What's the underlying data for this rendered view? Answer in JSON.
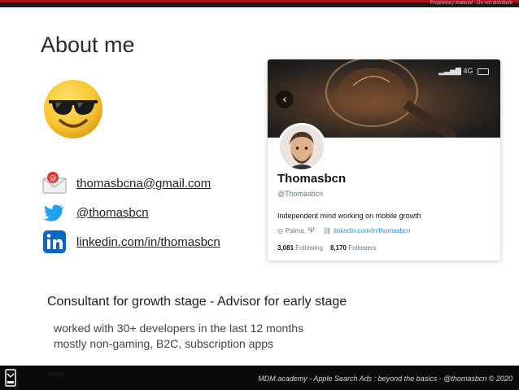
{
  "header": {
    "notice": "Proprietary material - Do not distribute"
  },
  "slide": {
    "title": "About me",
    "contacts": [
      {
        "icon": "email-icon",
        "text": "thomasbcna@gmail.com"
      },
      {
        "icon": "twitter-icon",
        "text": "@thomasbcn"
      },
      {
        "icon": "linkedin-icon",
        "text": "linkedin.com/in/thomasbcn"
      }
    ],
    "tagline": "Consultant for growth stage - Advisor for early stage",
    "details": [
      "worked with 30+ developers in the last 12 months",
      "mostly non-gaming, B2C, subscription apps"
    ]
  },
  "profile_card": {
    "status": "4G",
    "name": "Thomasbcn",
    "handle": "@Thomasbcn",
    "bio": "Independent mind working on mobile growth",
    "location": "Palma",
    "link": "linkedin.com/in/thomasbcn",
    "following_count": "3,081",
    "following_label": "Following",
    "followers_count": "8,170",
    "followers_label": "Followers"
  },
  "footer": {
    "text": "MDM.academy - Apple Search Ads : beyond the basics - @thomasbcn © 2020",
    "slide_id": "SSfree"
  },
  "colors": {
    "accent": "#b3121d",
    "link": "#1b95e0",
    "twitter": "#1da1f2",
    "linkedin": "#0a66c2"
  }
}
